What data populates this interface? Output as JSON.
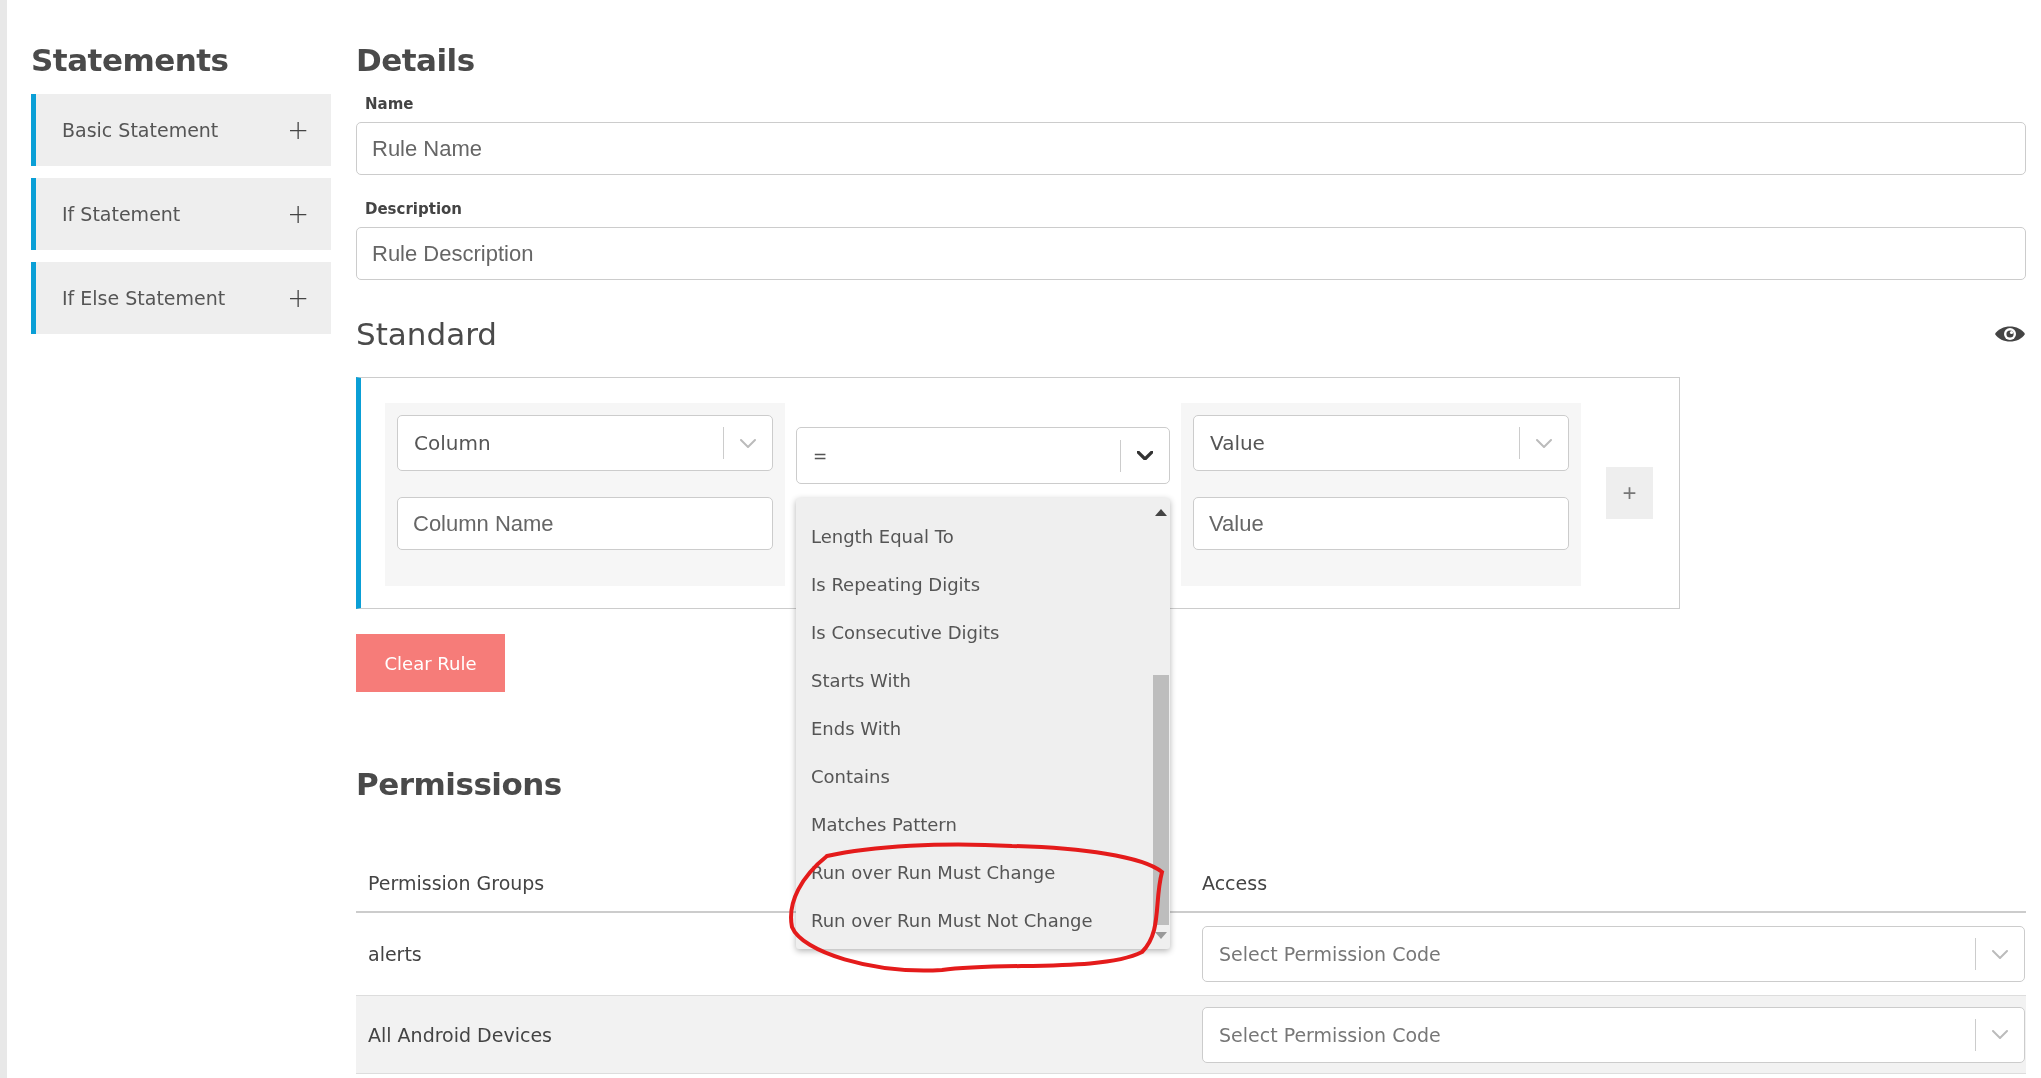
{
  "sidebar": {
    "title": "Statements",
    "items": [
      {
        "label": "Basic Statement",
        "add": "+"
      },
      {
        "label": "If Statement",
        "add": "+"
      },
      {
        "label": "If Else Statement",
        "add": "+"
      }
    ]
  },
  "details": {
    "title": "Details",
    "fields": [
      {
        "label": "Name",
        "placeholder": "Rule Name"
      },
      {
        "label": "Description",
        "placeholder": "Rule Description"
      }
    ]
  },
  "standard": {
    "title": "Standard",
    "rule": {
      "column_select": "Column",
      "column_placeholder": "Column Name",
      "operator_select": "=",
      "operator_expanded": true,
      "operator_options": [
        "Length Equal To",
        "Is Repeating Digits",
        "Is Consecutive Digits",
        "Starts With",
        "Ends With",
        "Contains",
        "Matches Pattern",
        "Run over Run Must Change",
        "Run over Run Must Not Change"
      ],
      "value_select": "Value",
      "value_placeholder": "Value",
      "add_button": "+"
    },
    "clear_button": "Clear Rule"
  },
  "permissions": {
    "title": "Permissions",
    "columns": [
      "Permission Groups",
      "Access"
    ],
    "rows": [
      {
        "group": "alerts",
        "access_placeholder": "Select Permission Code"
      },
      {
        "group": "All Android Devices",
        "access_placeholder": "Select Permission Code"
      }
    ]
  },
  "annotations": [
    {
      "kind": "freehand-circle"
    }
  ]
}
